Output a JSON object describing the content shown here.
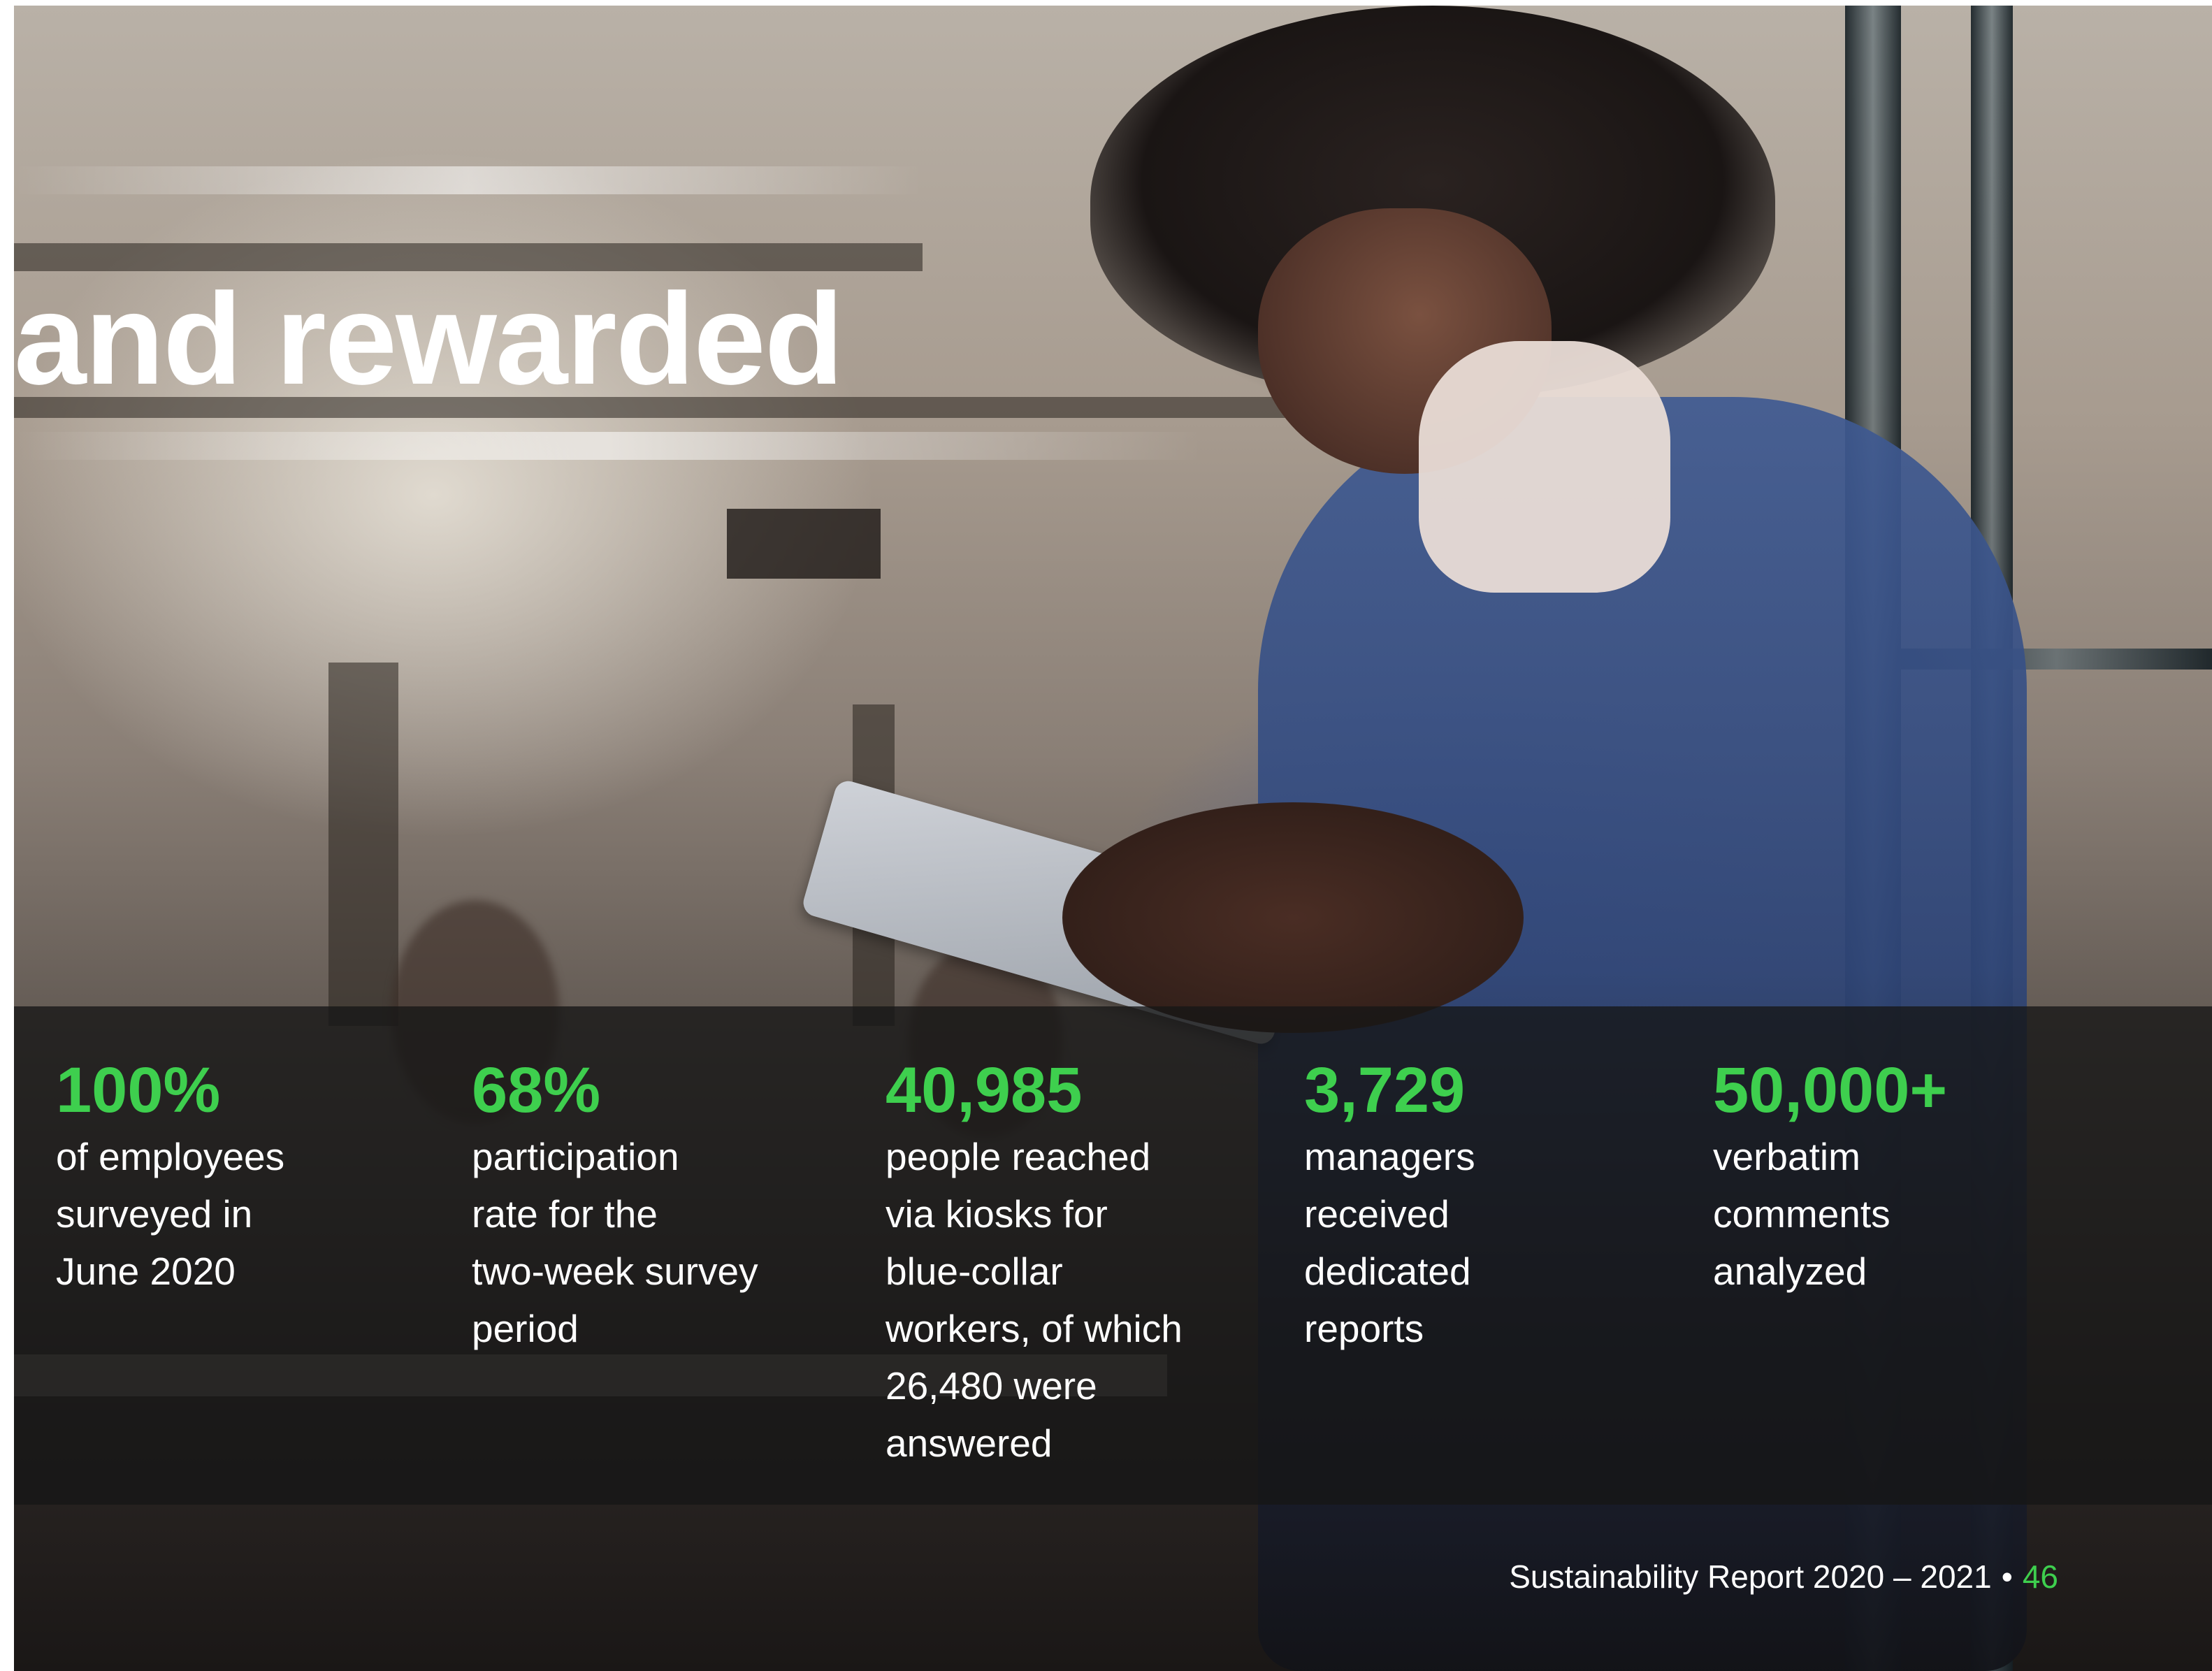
{
  "headline": "and rewarded",
  "stats": [
    {
      "value": "100%",
      "description": "of employees\nsurveyed in\nJune 2020"
    },
    {
      "value": "68%",
      "description": "participation\nrate for the\ntwo-week survey\nperiod"
    },
    {
      "value": "40,985",
      "description": "people reached\nvia kiosks for\nblue-collar\nworkers, of which\n26,480 were\nanswered"
    },
    {
      "value": "3,729",
      "description": "managers\nreceived\ndedicated\nreports"
    },
    {
      "value": "50,000+",
      "description": "verbatim\ncomments\nanalyzed"
    }
  ],
  "footer": {
    "report_title": "Sustainability Report 2020 – 2021",
    "separator": "•",
    "page_number": "46"
  },
  "colors": {
    "accent_green": "#3ecf4e",
    "text_white": "#ffffff",
    "band_overlay": "rgba(22,22,22,0.78)"
  }
}
